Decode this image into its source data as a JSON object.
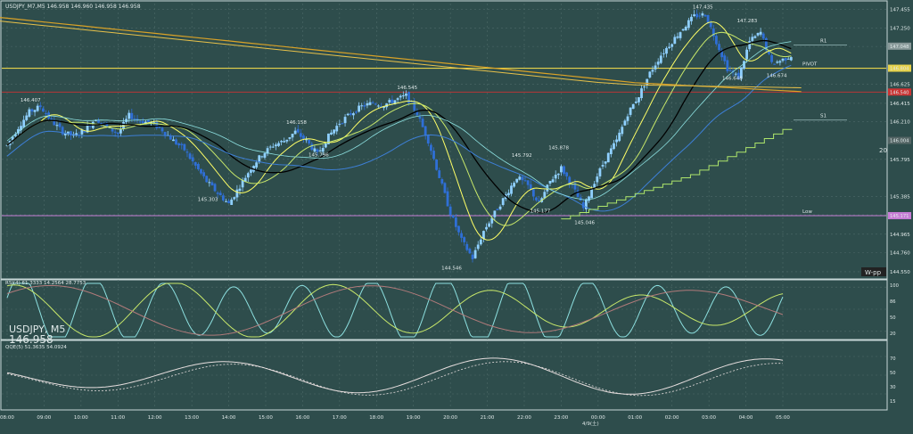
{
  "header": {
    "title_line": "USDJPY_M7,M5  146.958 146.960 146.958 146.958"
  },
  "symbol": {
    "name": "USDJPY, M5",
    "price": "146.958"
  },
  "watermark": "W-pp",
  "colors": {
    "background": "#2e4d4c",
    "grid": "#4d6a69",
    "bull_candle": "#8fd0ff",
    "bear_candle": "#2f6fd6",
    "ema_fast": "#ffff66",
    "ema_mid": "#c8e86a",
    "ma_black": "#000000",
    "ma_long": "#d9a227",
    "sar_step": "#aee66b",
    "bollinger": "#3d7fd6",
    "cyan_line": "#8de0e0",
    "pivot": "#e6d24a",
    "low_line": "#c77dd6",
    "high_level": "#cc3333"
  },
  "chart_data": [
    {
      "type": "candlestick",
      "title": "",
      "x_ticks": [
        "08:00",
        "09:00",
        "10:00",
        "11:00",
        "12:00",
        "13:00",
        "14:00",
        "15:00",
        "16:00",
        "17:00",
        "18:00",
        "19:00",
        "20:00",
        "21:00",
        "22:00",
        "23:00",
        "00:00",
        "01:00",
        "02:00",
        "03:00",
        "04:00",
        "05:00"
      ],
      "date_label": "4/9(土)",
      "y_ticks": [
        "147.455",
        "147.250",
        "147.045",
        "146.625",
        "146.415",
        "146.210",
        "145.795",
        "145.385",
        "145.180",
        "144.965",
        "144.760",
        "144.550"
      ],
      "ylim": [
        144.48,
        147.52
      ],
      "price_labels": [
        {
          "text": "146.407",
          "x": 0.6,
          "y": 146.407
        },
        {
          "text": "146.158",
          "x": 7.8,
          "y": 146.158
        },
        {
          "text": "145.796",
          "x": 8.4,
          "y": 145.796
        },
        {
          "text": "145.303",
          "x": 5.4,
          "y": 145.303
        },
        {
          "text": "146.545",
          "x": 10.8,
          "y": 146.545
        },
        {
          "text": "144.546",
          "x": 12.0,
          "y": 144.546
        },
        {
          "text": "145.792",
          "x": 13.9,
          "y": 145.792
        },
        {
          "text": "145.177",
          "x": 14.4,
          "y": 145.177
        },
        {
          "text": "145.878",
          "x": 14.9,
          "y": 145.878
        },
        {
          "text": "145.046",
          "x": 15.6,
          "y": 145.046
        },
        {
          "text": "147.435",
          "x": 18.8,
          "y": 147.435
        },
        {
          "text": "147.283",
          "x": 20.0,
          "y": 147.283
        },
        {
          "text": "146.648",
          "x": 19.6,
          "y": 146.648
        },
        {
          "text": "146.674",
          "x": 20.8,
          "y": 146.674
        }
      ],
      "levels": [
        {
          "name": "R1",
          "value": 147.06,
          "color": "#8aa"
        },
        {
          "name": "PIVOT",
          "value": 146.804,
          "color": "#e6d24a"
        },
        {
          "name": "",
          "value": 146.54,
          "color": "#cc3333"
        },
        {
          "name": "S1",
          "value": 146.23,
          "color": "#8aa"
        },
        {
          "name": "Low",
          "value": 145.171,
          "color": "#c77dd6"
        }
      ],
      "right_labels": [
        "147.048",
        "146.804",
        "146.540",
        "146.004",
        "145.171"
      ],
      "side_value": "20",
      "close_path": [
        [
          0,
          145.95
        ],
        [
          0.3,
          146.15
        ],
        [
          0.6,
          146.32
        ],
        [
          0.9,
          146.38
        ],
        [
          1.2,
          146.22
        ],
        [
          1.5,
          146.1
        ],
        [
          1.8,
          146.05
        ],
        [
          2.1,
          146.12
        ],
        [
          2.4,
          146.25
        ],
        [
          2.7,
          146.15
        ],
        [
          3.0,
          146.08
        ],
        [
          3.3,
          146.28
        ],
        [
          3.6,
          146.22
        ],
        [
          3.9,
          146.2
        ],
        [
          4.2,
          146.12
        ],
        [
          4.5,
          146.0
        ],
        [
          4.8,
          145.9
        ],
        [
          5.1,
          145.72
        ],
        [
          5.4,
          145.55
        ],
        [
          5.7,
          145.42
        ],
        [
          6.0,
          145.3
        ],
        [
          6.3,
          145.5
        ],
        [
          6.6,
          145.7
        ],
        [
          6.9,
          145.85
        ],
        [
          7.2,
          145.95
        ],
        [
          7.5,
          146.0
        ],
        [
          7.8,
          146.1
        ],
        [
          8.1,
          146.0
        ],
        [
          8.4,
          145.85
        ],
        [
          8.7,
          146.05
        ],
        [
          9.0,
          146.2
        ],
        [
          9.3,
          146.3
        ],
        [
          9.6,
          146.38
        ],
        [
          9.9,
          146.42
        ],
        [
          10.2,
          146.4
        ],
        [
          10.5,
          146.45
        ],
        [
          10.8,
          146.5
        ],
        [
          11.1,
          146.3
        ],
        [
          11.4,
          146.0
        ],
        [
          11.7,
          145.6
        ],
        [
          12.0,
          145.2
        ],
        [
          12.3,
          144.9
        ],
        [
          12.6,
          144.7
        ],
        [
          12.9,
          145.0
        ],
        [
          13.2,
          145.2
        ],
        [
          13.5,
          145.4
        ],
        [
          13.8,
          145.6
        ],
        [
          14.1,
          145.5
        ],
        [
          14.4,
          145.3
        ],
        [
          14.7,
          145.55
        ],
        [
          15.0,
          145.7
        ],
        [
          15.3,
          145.5
        ],
        [
          15.6,
          145.25
        ],
        [
          15.9,
          145.55
        ],
        [
          16.2,
          145.8
        ],
        [
          16.5,
          146.0
        ],
        [
          16.8,
          146.3
        ],
        [
          17.1,
          146.5
        ],
        [
          17.4,
          146.75
        ],
        [
          17.7,
          146.95
        ],
        [
          18.0,
          147.1
        ],
        [
          18.3,
          147.25
        ],
        [
          18.6,
          147.38
        ],
        [
          18.9,
          147.4
        ],
        [
          19.2,
          147.1
        ],
        [
          19.5,
          146.8
        ],
        [
          19.8,
          146.7
        ],
        [
          20.1,
          147.1
        ],
        [
          20.4,
          147.2
        ],
        [
          20.7,
          146.85
        ],
        [
          21.0,
          146.9
        ],
        [
          21.3,
          146.96
        ]
      ]
    },
    {
      "type": "line",
      "title": "",
      "label": "RSI(4) 61.3333 14.2564 28.7753",
      "ylim": [
        0,
        100
      ],
      "y_ticks": [
        "100",
        "86",
        "50",
        "20"
      ]
    },
    {
      "type": "line",
      "title": "",
      "label": "QQE(5) 51.3635 54.0924",
      "ylim": [
        0,
        100
      ],
      "y_ticks": [
        "70",
        "50",
        "30",
        "15"
      ]
    }
  ]
}
